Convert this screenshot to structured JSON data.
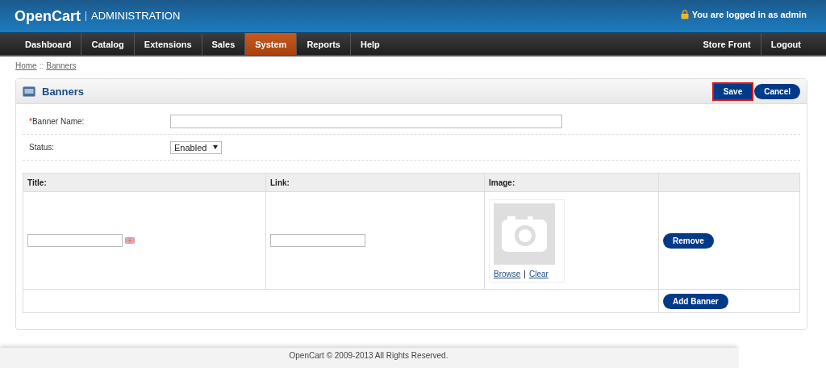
{
  "header": {
    "logo": "OpenCart",
    "subtitle": "ADMINISTRATION",
    "login_text": "You are logged in as admin"
  },
  "menu": [
    {
      "label": "Dashboard",
      "selected": false
    },
    {
      "label": "Catalog",
      "selected": false
    },
    {
      "label": "Extensions",
      "selected": false
    },
    {
      "label": "Sales",
      "selected": false
    },
    {
      "label": "System",
      "selected": true
    },
    {
      "label": "Reports",
      "selected": false
    },
    {
      "label": "Help",
      "selected": false
    }
  ],
  "menu_right": [
    "Store Front",
    "Logout"
  ],
  "breadcrumb": [
    {
      "label": "Home"
    },
    {
      "label": "Banners"
    }
  ],
  "breadcrumb_separator": "::",
  "panel": {
    "title": "Banners",
    "buttons": [
      {
        "label": "Save",
        "highlighted": true
      },
      {
        "label": "Cancel",
        "highlighted": false
      }
    ]
  },
  "required_mark": "*",
  "form": [
    {
      "label": "Banner Name:",
      "required": true,
      "kind": "text"
    },
    {
      "label": "Status:",
      "required": false,
      "kind": "select",
      "value": "Enabled"
    }
  ],
  "table": {
    "columns": [
      "Title:",
      "Link:",
      "Image:"
    ],
    "rows": [
      {
        "image_links": [
          "Browse",
          "Clear"
        ],
        "image_separator": "|",
        "action": "Remove"
      }
    ],
    "footer_button": "Add Banner"
  },
  "footer": "OpenCart © 2009-2013 All Rights Reserved."
}
